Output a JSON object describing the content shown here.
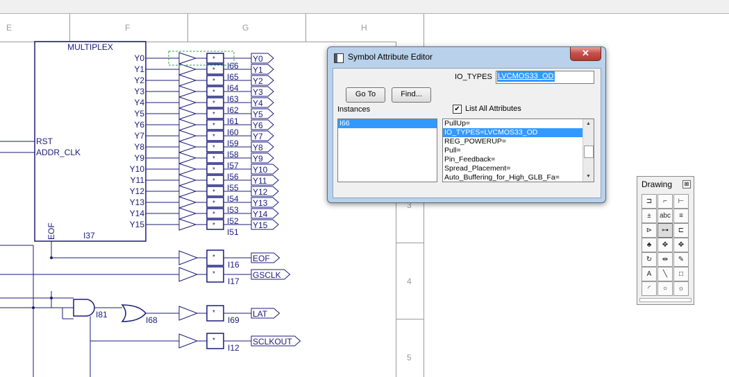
{
  "schematic": {
    "column_headers": [
      "E",
      "F",
      "G",
      "H"
    ],
    "row_numbers": [
      "3",
      "4",
      "5"
    ],
    "block": {
      "title": "MULTIPLEX",
      "instance": "I37",
      "inputs": [
        "RST",
        "ADDR_CLK"
      ],
      "bottom_pin": "EOF",
      "outputs": [
        "Y0",
        "Y1",
        "Y2",
        "Y3",
        "Y4",
        "Y5",
        "Y6",
        "Y7",
        "Y8",
        "Y9",
        "Y10",
        "Y11",
        "Y12",
        "Y13",
        "Y14",
        "Y15"
      ]
    },
    "buffer_mark": "*",
    "buffer_instances": [
      "I66",
      "I65",
      "I64",
      "I63",
      "I62",
      "I61",
      "I60",
      "I59",
      "I58",
      "I57",
      "I56",
      "I55",
      "I54",
      "I53",
      "I52",
      "I51"
    ],
    "output_ports": [
      "Y0",
      "Y1",
      "Y2",
      "Y3",
      "Y4",
      "Y5",
      "Y6",
      "Y7",
      "Y8",
      "Y9",
      "Y10",
      "Y11",
      "Y12",
      "Y13",
      "Y14",
      "Y15"
    ],
    "extra_buffers": [
      {
        "instance": "I16",
        "port": "EOF"
      },
      {
        "instance": "I17",
        "port": "GSCLK"
      },
      {
        "instance": "I69",
        "port": "LAT"
      },
      {
        "instance": "I12",
        "port": "SCLKOUT"
      }
    ],
    "and_gate": "I81",
    "or_gate": "I68"
  },
  "dialog": {
    "title": "Symbol Attribute Editor",
    "close_glyph": "✕",
    "attr_name": "IO_TYPES",
    "attr_value": "LVCMOS33_OD",
    "goto_label": "Go To",
    "find_label": "Find...",
    "instances_label": "Instances",
    "list_all_label": "List All Attributes",
    "list_all_checked": true,
    "check_glyph": "✔",
    "instances": [
      "I66"
    ],
    "attributes": [
      "PullUp=",
      "IO_TYPES=LVCMOS33_OD",
      "REG_POWERUP=",
      "Pull=",
      "Pin_Feedback=",
      "Spread_Placement=",
      "Auto_Buffering_for_High_GLB_Fa="
    ],
    "selected_attribute_index": 1
  },
  "palette": {
    "title": "Drawing",
    "close_glyph": "⊠",
    "tools": [
      {
        "name": "symbol-tool",
        "glyph": "⊐"
      },
      {
        "name": "wire-tool",
        "glyph": "⌐"
      },
      {
        "name": "bus-tap-tool",
        "glyph": "⊢"
      },
      {
        "name": "net-name-tool",
        "glyph": "±"
      },
      {
        "name": "text-abc-tool",
        "glyph": "abc"
      },
      {
        "name": "attribute-tool",
        "glyph": "≡"
      },
      {
        "name": "io-marker-tool",
        "glyph": "⊳"
      },
      {
        "name": "port-tool",
        "glyph": "⊶"
      },
      {
        "name": "pin-tool",
        "glyph": "⊏"
      },
      {
        "name": "hierarchy-tool",
        "glyph": "♣"
      },
      {
        "name": "move-tool",
        "glyph": "✥"
      },
      {
        "name": "drag-tool",
        "glyph": "✥"
      },
      {
        "name": "rotate-tool",
        "glyph": "↻"
      },
      {
        "name": "mirror-tool",
        "glyph": "⇹"
      },
      {
        "name": "edit-tool",
        "glyph": "✎"
      },
      {
        "name": "text-tool",
        "glyph": "A"
      },
      {
        "name": "line-tool",
        "glyph": "╲"
      },
      {
        "name": "rectangle-tool",
        "glyph": "□"
      },
      {
        "name": "arc-tool",
        "glyph": "◜"
      },
      {
        "name": "circle-tool",
        "glyph": "○"
      },
      {
        "name": "graphic-tool",
        "glyph": "☼"
      }
    ]
  }
}
